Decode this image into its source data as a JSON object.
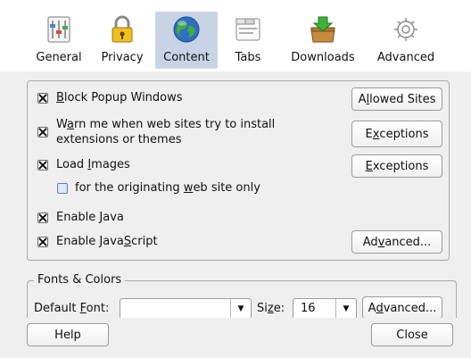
{
  "tabs": [
    {
      "id": "general",
      "label": "General",
      "icon": "general-icon"
    },
    {
      "id": "privacy",
      "label": "Privacy",
      "icon": "privacy-lock-icon"
    },
    {
      "id": "content",
      "label": "Content",
      "icon": "globe-icon",
      "selected": true
    },
    {
      "id": "tabs",
      "label": "Tabs",
      "icon": "tabs-icon"
    },
    {
      "id": "downloads",
      "label": "Downloads",
      "icon": "downloads-icon"
    },
    {
      "id": "advanced",
      "label": "Advanced",
      "icon": "gear-icon"
    }
  ],
  "content": {
    "block_popups": {
      "pre": "",
      "accel": "B",
      "post": "lock Popup Windows",
      "checked": true
    },
    "warn_install": {
      "line1_pre": "W",
      "line1_accel": "a",
      "line1_post": "rn me when web sites try to install",
      "line2": "extensions or themes",
      "checked": true
    },
    "load_images": {
      "pre": "Load ",
      "accel": "I",
      "post": "mages",
      "checked": true
    },
    "originating": {
      "pre": "for the originating ",
      "accel": "w",
      "post": "eb site only",
      "checked": false
    },
    "enable_java": {
      "pre": "Enable ",
      "accel": "J",
      "post": "ava",
      "checked": true
    },
    "enable_js": {
      "pre": "Enable Java",
      "accel": "S",
      "post": "cript",
      "checked": true
    },
    "buttons": {
      "allowed_sites": {
        "pre": "A",
        "accel": "l",
        "post": "lowed Sites"
      },
      "exceptions_1": {
        "pre": "E",
        "accel": "x",
        "post": "ceptions"
      },
      "exceptions_2": {
        "pre": "",
        "accel": "E",
        "post": "xceptions"
      },
      "advanced_js": {
        "pre": "Ad",
        "accel": "v",
        "post": "anced..."
      }
    }
  },
  "fonts": {
    "legend": "Fonts & Colors",
    "default_font_pre": "Default ",
    "default_font_accel": "F",
    "default_font_post": "ont:",
    "font_value": "",
    "size_pre": "Si",
    "size_accel": "z",
    "size_post": "e:",
    "size_value": "16",
    "advanced_pre": "A",
    "advanced_accel": "d",
    "advanced_post": "vanced..."
  },
  "footer": {
    "help": "Help",
    "close": "Close"
  },
  "colors": {
    "selected_tab_bg": "#c8d4e6",
    "toolbar_bg": "#ffffff",
    "dialog_bg": "#efefef"
  }
}
